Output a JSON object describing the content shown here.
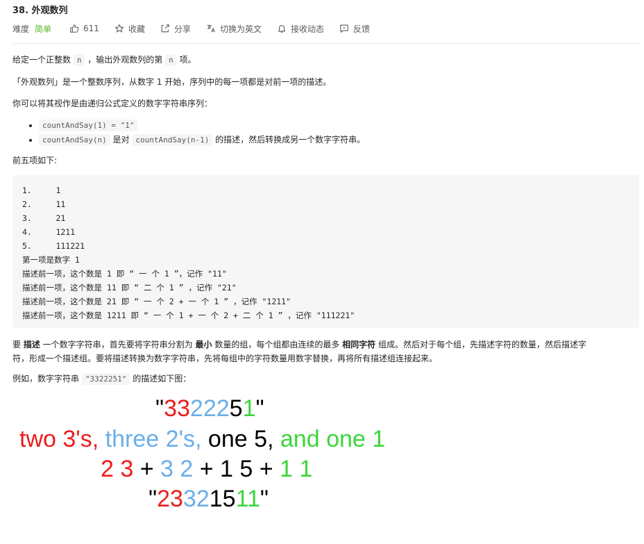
{
  "problem": {
    "title": "38. 外观数列",
    "difficulty_label": "难度",
    "difficulty_value": "简单",
    "likes": "611",
    "favorite_label": "收藏",
    "share_label": "分享",
    "lang_switch_label": "切换为英文",
    "subscribe_label": "接收动态",
    "feedback_label": "反馈"
  },
  "desc": {
    "p1_a": "给定一个正整数 ",
    "p1_code": "n",
    "p1_b": " ，输出外观数列的第 ",
    "p1_code2": "n",
    "p1_c": " 项。",
    "p2": "「外观数列」是一个整数序列，从数字 1 开始，序列中的每一项都是对前一项的描述。",
    "p3": "你可以将其视作是由递归公式定义的数字字符串序列：",
    "b1_code": "countAndSay(1) = \"1\"",
    "b2_code1": "countAndSay(n)",
    "b2_mid": " 是对 ",
    "b2_code2": "countAndSay(n-1)",
    "b2_end": " 的描述，然后转换成另一个数字字符串。",
    "p4": "前五项如下:",
    "pre": "1.     1\n2.     11\n3.     21\n4.     1211\n5.     111221\n第一项是数字 1\n描述前一项，这个数是 1 即 “ 一 个 1 ”，记作 \"11\"\n描述前一项，这个数是 11 即 “ 二 个 1 ” ，记作 \"21\"\n描述前一项，这个数是 21 即 “ 一 个 2 + 一 个 1 ” ，记作 \"1211\"\n描述前一项，这个数是 1211 即 “ 一 个 1 + 一 个 2 + 二 个 1 ” ，记作 \"111221\"",
    "p5_a": "要 ",
    "p5_b1": "描述",
    "p5_c": " 一个数字字符串，首先要将字符串分割为 ",
    "p5_b2": "最小",
    "p5_d": " 数量的组，每个组都由连续的最多 ",
    "p5_b3": "相同字符",
    "p5_e": " 组成。然后对于每个组，先描述字符的数量，然后描述字",
    "p5_f": "符，形成一个描述组。要将描述转换为数字字符串，先将每组中的字符数量用数字替换，再将所有描述组连接起来。",
    "p6_a": "例如，数字字符串 ",
    "p6_code": "\"3322251\"",
    "p6_b": " 的描述如下图："
  },
  "figure": {
    "l1_q1": "\"",
    "l1_red": "33",
    "l1_blue": "222",
    "l1_black": "5",
    "l1_green": "1",
    "l1_q2": "\"",
    "l2_red": "two 3's,",
    "l2_blue": "three 2's,",
    "l2_black": "one 5,",
    "l2_green": "and one 1",
    "l3_red": "2 3",
    "l3_p1": " + ",
    "l3_blue": "3 2",
    "l3_p2": " + 1 5 + ",
    "l3_green": "1 1",
    "l4_q1": "\"",
    "l4_red": "23",
    "l4_blue": "32",
    "l4_black": "15",
    "l4_green": "11",
    "l4_q2": "\"",
    "colors": {
      "red": "#ee1c1c",
      "blue": "#6aaee8",
      "green": "#3bd53b"
    }
  }
}
